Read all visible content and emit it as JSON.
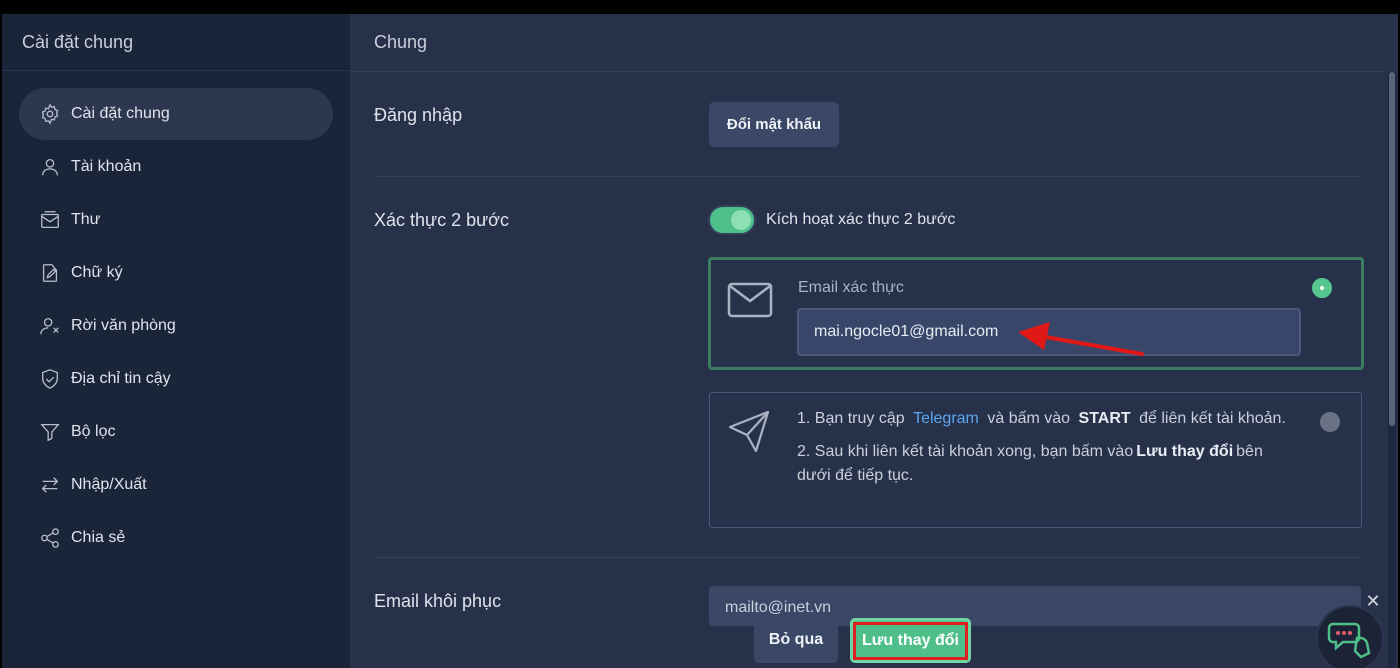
{
  "sidebar": {
    "title": "Cài đặt chung",
    "items": [
      {
        "label": "Cài đặt chung",
        "icon": "gear-icon",
        "active": true
      },
      {
        "label": "Tài khoản",
        "icon": "user-icon"
      },
      {
        "label": "Thư",
        "icon": "mail-icon"
      },
      {
        "label": "Chữ ký",
        "icon": "signature-icon"
      },
      {
        "label": "Rời văn phòng",
        "icon": "user-away-icon"
      },
      {
        "label": "Địa chỉ tin cậy",
        "icon": "shield-check-icon"
      },
      {
        "label": "Bộ lọc",
        "icon": "filter-icon"
      },
      {
        "label": "Nhập/Xuất",
        "icon": "import-export-icon"
      },
      {
        "label": "Chia sẻ",
        "icon": "share-icon"
      }
    ]
  },
  "main": {
    "title": "Chung",
    "login": {
      "label": "Đăng nhập",
      "change_password": "Đổi mật khẩu"
    },
    "two_factor": {
      "label": "Xác thực 2 bước",
      "toggle_label": "Kích hoạt xác thực 2 bước",
      "enabled": true,
      "email_caption": "Email xác thực",
      "email_value": "mai.ngocle01@gmail.com",
      "tg_step1_prefix": "1. Bạn truy cập",
      "tg_link": "Telegram",
      "tg_step1_mid": "và bấm vào",
      "tg_start": "START",
      "tg_step1_suffix": "để liên kết tài khoản.",
      "tg_step2_prefix": "2. Sau khi liên kết tài khoản xong, bạn bấm vào",
      "tg_step2_bold": "Lưu thay đổi",
      "tg_step2_suffix": "bên dưới để tiếp tục."
    },
    "recovery": {
      "label": "Email khôi phục",
      "value": "mailto@inet.vn"
    },
    "actions": {
      "cancel": "Bỏ qua",
      "save": "Lưu thay đổi"
    }
  },
  "colors": {
    "accent": "#4fbf8a",
    "link": "#5aa6f0",
    "highlight": "#e02020"
  }
}
